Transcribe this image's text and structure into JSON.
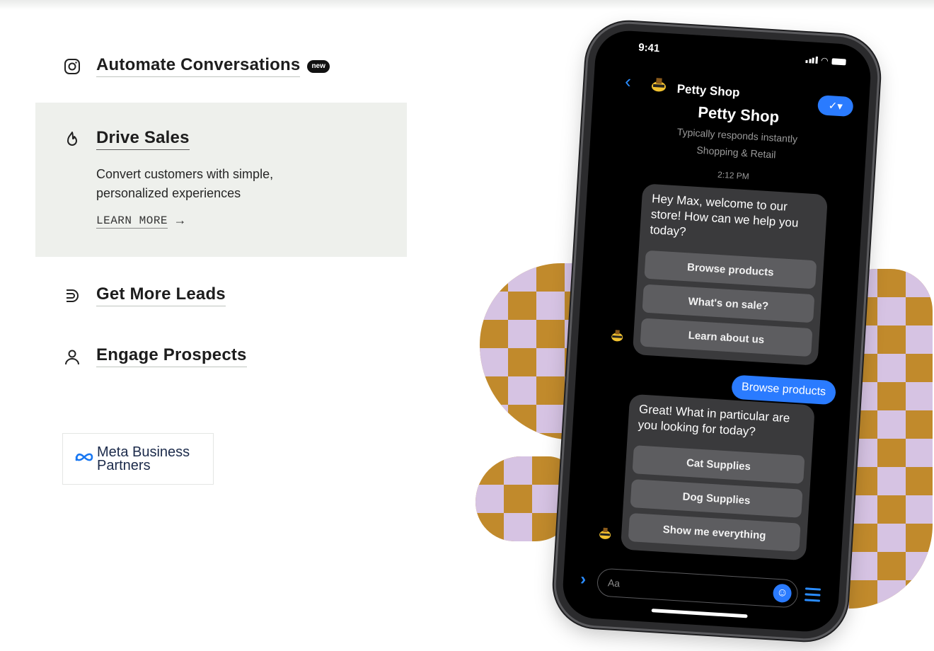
{
  "menu": {
    "items": [
      {
        "title": "Automate Conversations",
        "badge": "new",
        "icon": "instagram-icon"
      },
      {
        "title": "Drive Sales",
        "icon": "flame-icon",
        "description": "Convert customers with simple, personalized experiences",
        "cta": "LEARN MORE"
      },
      {
        "title": "Get More Leads",
        "icon": "magnet-icon"
      },
      {
        "title": "Engage Prospects",
        "icon": "person-icon"
      }
    ]
  },
  "partner": {
    "brand": "Meta Business",
    "subtitle": "Partners"
  },
  "phone": {
    "status_time": "9:41",
    "shop_name": "Petty Shop",
    "responds": "Typically responds instantly",
    "category": "Shopping & Retail",
    "message_time": "2:12 PM",
    "bot_message_1": "Hey Max, welcome to our store! How can we help you today?",
    "quick_replies_1": [
      "Browse products",
      "What's on sale?",
      "Learn about us"
    ],
    "user_message": "Browse products",
    "bot_message_2": "Great! What in particular are you looking for today?",
    "quick_replies_2": [
      "Cat Supplies",
      "Dog Supplies",
      "Show me everything"
    ],
    "composer_placeholder": "Aa"
  },
  "colors": {
    "panel_bg": "#eef0ec",
    "messenger_blue": "#2a7bff",
    "checker_gold": "#c18a2c",
    "checker_lilac": "#d6c3e3"
  }
}
